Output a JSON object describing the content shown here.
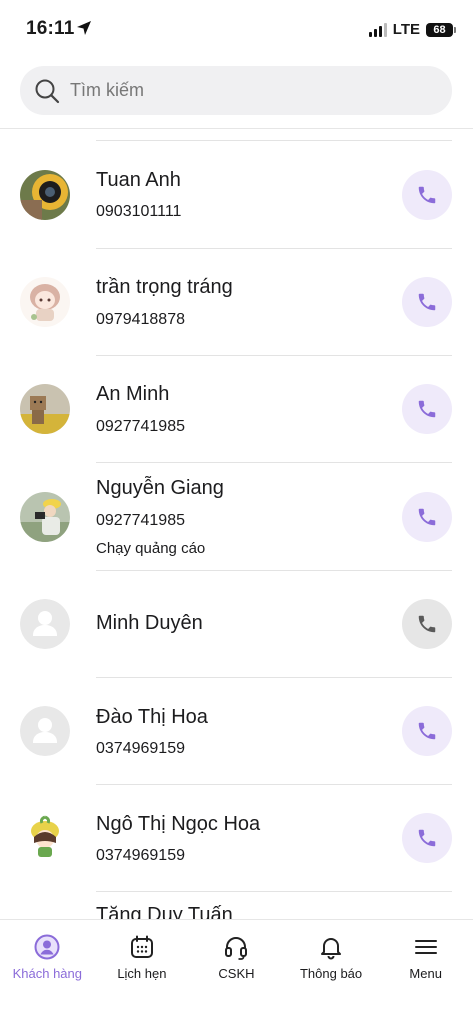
{
  "status_bar": {
    "time": "16:11",
    "network": "LTE",
    "battery": "68"
  },
  "search": {
    "placeholder": "Tìm kiếm"
  },
  "colors": {
    "accent": "#8b6cd9",
    "call_bg": "#efeafa",
    "disabled": "#e6e6e6"
  },
  "contacts": [
    {
      "name": "Tuan Anh",
      "phone": "0903101111",
      "note": "",
      "avatar": "photo-camera-lens",
      "call_enabled": true
    },
    {
      "name": "trần trọng tráng",
      "phone": "0979418878",
      "note": "",
      "avatar": "anime-girl-drawing",
      "call_enabled": true
    },
    {
      "name": "An Minh",
      "phone": "0927741985",
      "note": "",
      "avatar": "photo-cardboard-robot",
      "call_enabled": true
    },
    {
      "name": "Nguyễn Giang",
      "phone": "0927741985",
      "note": "Chạy quảng cáo",
      "avatar": "photo-photographer-field",
      "call_enabled": true
    },
    {
      "name": "Minh Duyên",
      "phone": "",
      "note": "",
      "avatar": "default-person",
      "call_enabled": false
    },
    {
      "name": "Đào Thị Hoa",
      "phone": "0374969159",
      "note": "",
      "avatar": "default-person",
      "call_enabled": true
    },
    {
      "name": "Ngô Thị Ngọc Hoa",
      "phone": "0374969159",
      "note": "",
      "avatar": "cartoon-sprout-girl",
      "call_enabled": true
    },
    {
      "name": "Tăng Duy Tuấn",
      "phone": "",
      "note": "",
      "avatar": "",
      "call_enabled": true
    }
  ],
  "tabs": [
    {
      "label": "Khách hàng",
      "icon": "user-circle-icon",
      "active": true
    },
    {
      "label": "Lịch hẹn",
      "icon": "calendar-icon",
      "active": false
    },
    {
      "label": "CSKH",
      "icon": "headset-icon",
      "active": false
    },
    {
      "label": "Thông báo",
      "icon": "bell-icon",
      "active": false
    },
    {
      "label": "Menu",
      "icon": "hamburger-menu-icon",
      "active": false
    }
  ]
}
